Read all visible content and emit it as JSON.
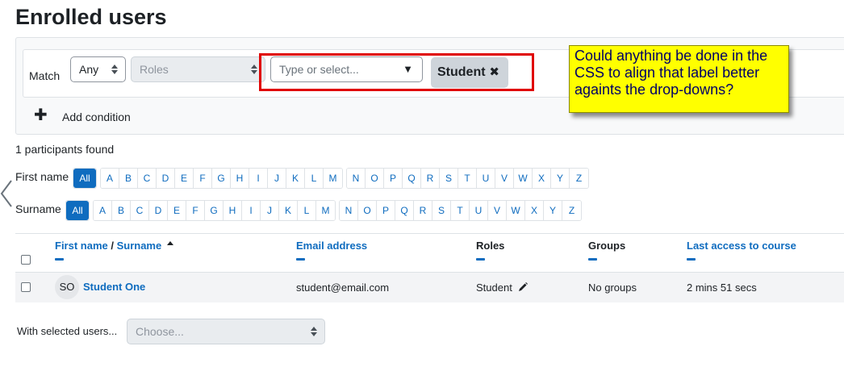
{
  "page": {
    "title": "Enrolled users"
  },
  "filter": {
    "match_label": "Match",
    "match_value": "Any",
    "type_value": "Roles",
    "value_placeholder": "Type or select...",
    "value_arrow": "▼",
    "selected_badge": "Student",
    "remove_glyph": "✖",
    "add_plus": "✚",
    "add_condition_label": "Add condition"
  },
  "annotation": {
    "text": "Could anything be done in the CSS to align that label better againts the drop-downs?"
  },
  "results": {
    "count_text": "1 participants found"
  },
  "initials": {
    "first_label": "First name",
    "surname_label": "Surname",
    "all_label": "All",
    "groups": [
      [
        "A",
        "B",
        "C",
        "D",
        "E",
        "F",
        "G",
        "H",
        "I",
        "J",
        "K",
        "L",
        "M"
      ],
      [
        "N",
        "O",
        "P",
        "Q",
        "R",
        "S",
        "T",
        "U",
        "V",
        "W",
        "X",
        "Y",
        "Z"
      ]
    ]
  },
  "table": {
    "headers": {
      "first_name": "First name",
      "separator": " / ",
      "surname": "Surname",
      "email": "Email address",
      "roles": "Roles",
      "groups": "Groups",
      "last_access": "Last access to course"
    },
    "rows": [
      {
        "initials": "SO",
        "name": "Student One",
        "email": "student@email.com",
        "role": "Student",
        "groups": "No groups",
        "last_access": "2 mins 51 secs"
      }
    ]
  },
  "bulk": {
    "label": "With selected users...",
    "placeholder": "Choose..."
  },
  "colors": {
    "link": "#0f6cbf",
    "annotation_bg": "#ffff00",
    "highlight_border": "#e00000"
  }
}
